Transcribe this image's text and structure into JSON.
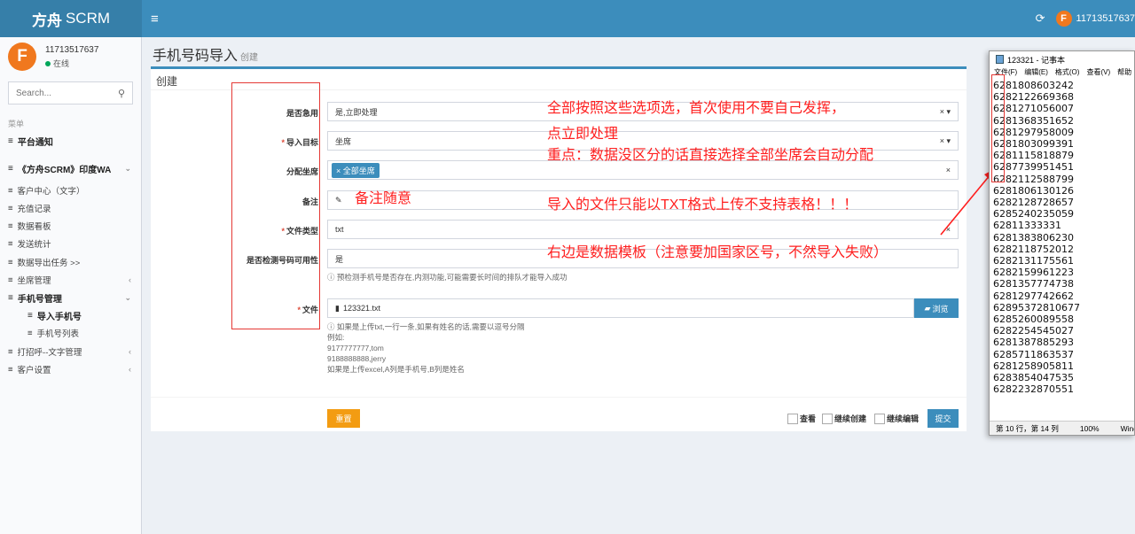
{
  "app": {
    "brand_bold": "方舟",
    "brand_rest": "SCRM",
    "username": "11713517637",
    "menu_glyph": "≡",
    "refresh_glyph": "⟳"
  },
  "user": {
    "avatar_letter": "F",
    "id": "11713517637",
    "status": "在线"
  },
  "sidebar": {
    "search_placeholder": "Search...",
    "menu_header": "菜单",
    "items": [
      {
        "label": "平台通知"
      },
      {
        "label": "《方舟SCRM》印度WA"
      },
      {
        "label": "客户中心（文字）"
      },
      {
        "label": "充值记录"
      },
      {
        "label": "数据看板"
      },
      {
        "label": "发送统计"
      },
      {
        "label": "数据导出任务 >>"
      },
      {
        "label": "坐席管理"
      },
      {
        "label": "手机号管理"
      },
      {
        "label": "导入手机号"
      },
      {
        "label": "手机号列表"
      },
      {
        "label": "打招呼--文字管理"
      },
      {
        "label": "客户设置"
      }
    ]
  },
  "page": {
    "title": "手机号码导入",
    "subtitle": "创建",
    "box_title": "创建"
  },
  "form": {
    "urgent_label": "是否急用",
    "urgent_value": "是,立即处理",
    "target_label": "导入目标",
    "target_value": "坐席",
    "assign_label": "分配坐席",
    "assign_tag": "× 全部坐席",
    "note_label": "备注",
    "filetype_label": "文件类型",
    "filetype_value": "txt",
    "check_label": "是否检测号码可用性",
    "check_value": "是",
    "check_help": "预检测手机号是否存在,内测功能,可能需要长时间的排队才能导入成功",
    "file_label": "文件",
    "file_value": "123321.txt",
    "browse_label": "浏览",
    "file_help": [
      "如果是上传txt,一行一条,如果有姓名的话,需要以逗号分隔",
      "例如:",
      "9177777777,tom",
      "9188888888,jerry",
      "如果是上传excel,A列是手机号,B列是姓名"
    ],
    "clear_glyph": "×",
    "dropdown_glyph": "× ▾",
    "reset_label": "重置",
    "view_label": "查看",
    "continue_create_label": "继续创建",
    "continue_edit_label": "继续编辑",
    "submit_label": "提交"
  },
  "annotations": {
    "line1": "全部按照这些选项选，首次使用不要自己发挥，",
    "line2": "点立即处理",
    "line3": "重点：数据没区分的话直接选择全部坐席会自动分配",
    "note": "备注随意",
    "txt_only": "导入的文件只能以TXT格式上传不支持表格！！！",
    "template": "右边是数据模板（注意要加国家区号，不然导入失败）"
  },
  "notepad": {
    "title": "123321 - 记事本",
    "menu": [
      "文件(F)",
      "编辑(E)",
      "格式(O)",
      "查看(V)",
      "帮助"
    ],
    "lines": [
      "6281808603242",
      "6282122669368",
      "6281271056007",
      "6281368351652",
      "6281297958009",
      "6281803099391",
      "6281115818879",
      "6287739951451",
      "6282112588799",
      "6281806130126",
      "6282128728657",
      "6285240235059",
      "62811333331",
      "6281383806230",
      "6282118752012",
      "6282131175561",
      "6282159961223",
      "6281357774738",
      "6281297742662",
      "62895372810677",
      "6285260089558",
      "6282254545027",
      "6281387885293",
      "6285711863537",
      "6281258905811",
      "6283854047535",
      "6282232870551"
    ],
    "status_pos": "第 10 行，第 14 列",
    "status_zoom": "100%",
    "status_eol": "Windows"
  },
  "colors": {
    "primary": "#3c8dbc",
    "primary_dark": "#367fa9",
    "warning": "#f39c12",
    "annotation": "#ff1f1f"
  }
}
